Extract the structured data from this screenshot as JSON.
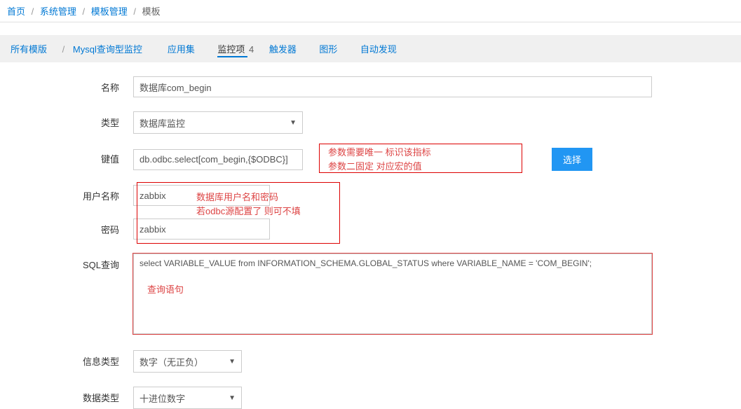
{
  "breadcrumb": {
    "home": "首页",
    "sys_mgmt": "系统管理",
    "tpl_mgmt": "模板管理",
    "current": "模板"
  },
  "tabs": {
    "all_templates": "所有模版",
    "mysql_monitor": "Mysql查询型监控",
    "app_set": "应用集",
    "monitor_item": "监控项",
    "monitor_count": "4",
    "trigger": "触发器",
    "graph": "图形",
    "auto_discover": "自动发现"
  },
  "form": {
    "name_label": "名称",
    "name_value": "数据库com_begin",
    "type_label": "类型",
    "type_value": "数据库监控",
    "key_label": "键值",
    "key_value": "db.odbc.select[com_begin,{$ODBC}]",
    "select_button": "选择",
    "username_label": "用户名称",
    "username_value": "zabbix",
    "password_label": "密码",
    "password_value": "zabbix",
    "sql_label": "SQL查询",
    "sql_value": "select VARIABLE_VALUE from INFORMATION_SCHEMA.GLOBAL_STATUS where VARIABLE_NAME = 'COM_BEGIN';",
    "info_type_label": "信息类型",
    "info_type_value": "数字（无正负）",
    "data_type_label": "数据类型",
    "data_type_value": "十进位数字"
  },
  "annotations": {
    "key_note_line1": "参数需要唯一 标识该指标",
    "key_note_line2": "参数二固定 对应宏的值",
    "user_note_line1": "数据库用户名和密码",
    "user_note_line2": "若odbc源配置了 则可不填",
    "sql_note": "查询语句"
  }
}
